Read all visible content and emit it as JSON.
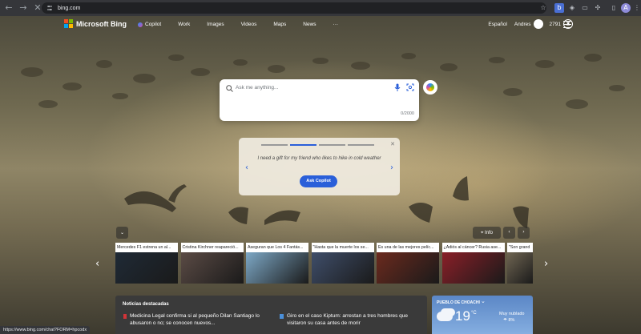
{
  "browser": {
    "url": "bing.com",
    "status_url": "https://www.bing.com/chat?FORM=hpcodx",
    "profile_initial": "A"
  },
  "header": {
    "brand": "Microsoft Bing",
    "nav": [
      "Copilot",
      "Work",
      "Images",
      "Videos",
      "Maps",
      "News"
    ],
    "more": "···",
    "language": "Español",
    "user": "Andres",
    "points": "2791"
  },
  "search": {
    "placeholder": "Ask me anything...",
    "counter": "0/2000"
  },
  "prompt_card": {
    "text": "I need a gift for my friend who likes to hike in cold weather",
    "button": "Ask Copilot"
  },
  "info_label": "Info",
  "news_strip": [
    {
      "title": "Mercedes F1 estrena un al...",
      "color": "#1f2a36"
    },
    {
      "title": "Cristina Kirchner reapareció...",
      "color": "#5b4b45"
    },
    {
      "title": "Aseguran que Los 4 Fantás...",
      "color": "#7da8c6"
    },
    {
      "title": "\"Hasta que la muerte los se...",
      "color": "#3f4e6a"
    },
    {
      "title": "Es una de las mejores pelíc...",
      "color": "#6b2a1e"
    },
    {
      "title": "¿Adiós al cáncer? Rusia ase...",
      "color": "#8a1f28"
    },
    {
      "title": "\"Son grand",
      "color": "#6f6552"
    }
  ],
  "featured": {
    "heading": "Noticias destacadas",
    "items": [
      {
        "title": "Medicina Legal confirma si al pequeño Dilan Santiago lo abusaron o no; se conocen nuevos..."
      },
      {
        "title": "Giro en el caso Kiptum: arrestan a tres hombres que visitaron su casa antes de morir"
      }
    ]
  },
  "weather": {
    "location": "PUEBLO DE CHOACHI",
    "temp": "19",
    "unit": "°C",
    "condition": "Muy nublado",
    "rain": "☂ 8%"
  },
  "colors": {
    "accent": "#2a5fd9",
    "ms_red": "#f25022",
    "ms_green": "#7fba00",
    "ms_blue": "#00a4ef",
    "ms_yellow": "#ffb900"
  }
}
